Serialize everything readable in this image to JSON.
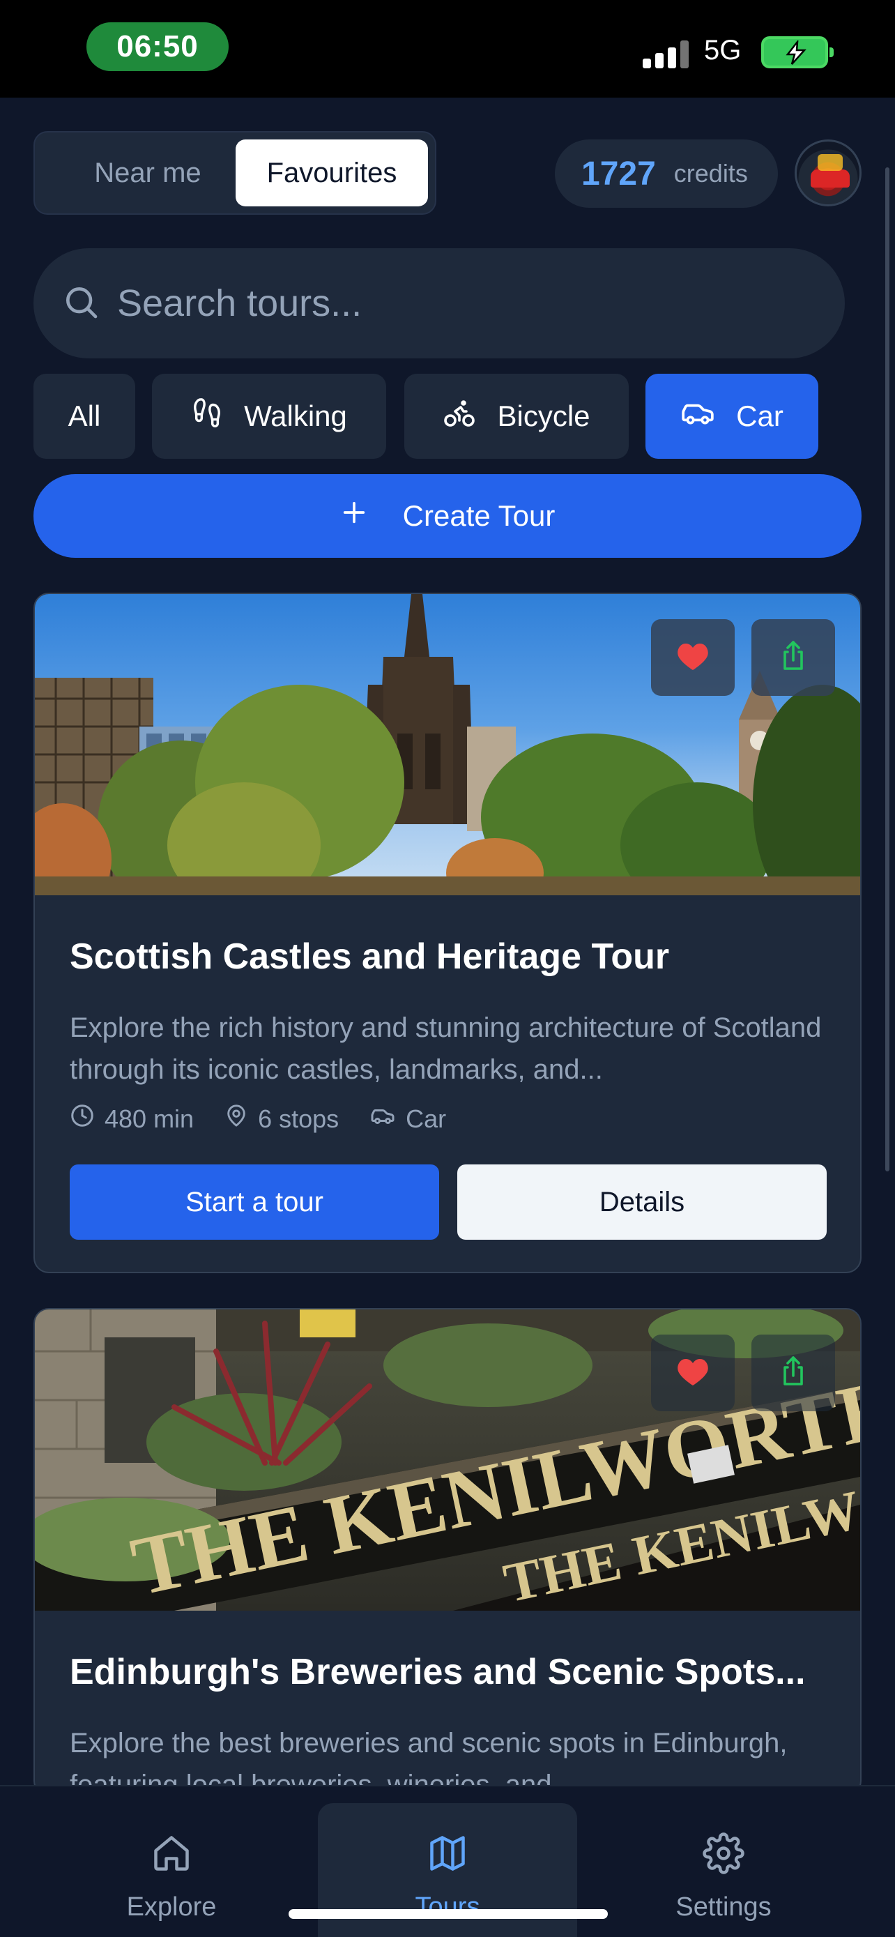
{
  "status_bar": {
    "time": "06:50",
    "network": "5G"
  },
  "top": {
    "segments": [
      {
        "label": "Near me",
        "active": false
      },
      {
        "label": "Favourites",
        "active": true
      }
    ],
    "credits_value": "1727",
    "credits_label": "credits"
  },
  "search": {
    "placeholder": "Search tours..."
  },
  "filters": [
    {
      "label": "All",
      "active": false
    },
    {
      "label": "Walking",
      "icon": "footprints-icon",
      "active": false
    },
    {
      "label": "Bicycle",
      "icon": "bicycle-icon",
      "active": false
    },
    {
      "label": "Car",
      "icon": "car-icon",
      "active": true
    }
  ],
  "create_tour": {
    "label": "Create Tour",
    "icon": "plus-icon"
  },
  "tours": [
    {
      "title": "Scottish Castles and Heritage Tour",
      "description": "Explore the rich history and stunning architecture of Scotland through its iconic castles, landmarks, and...",
      "duration": "480 min",
      "stops": "6 stops",
      "mode": "Car",
      "start_label": "Start a tour",
      "details_label": "Details",
      "favourited": true
    },
    {
      "title": "Edinburgh's Breweries and Scenic Spots...",
      "description": "Explore the best breweries and scenic spots in Edinburgh, featuring local breweries, wineries, and",
      "sign_text_1": "THE KENILWORTH",
      "sign_text_2": "THE KENILWO",
      "favourited": true
    }
  ],
  "bottom_nav": [
    {
      "label": "Explore",
      "icon": "home-icon",
      "active": false
    },
    {
      "label": "Tours",
      "icon": "map-icon",
      "active": true
    },
    {
      "label": "Settings",
      "icon": "gear-icon",
      "active": false
    }
  ],
  "colors": {
    "accent": "#2563eb",
    "background": "#0f172a",
    "surface": "#1e293b",
    "favourite": "#ef4444",
    "share": "#22c55e"
  }
}
